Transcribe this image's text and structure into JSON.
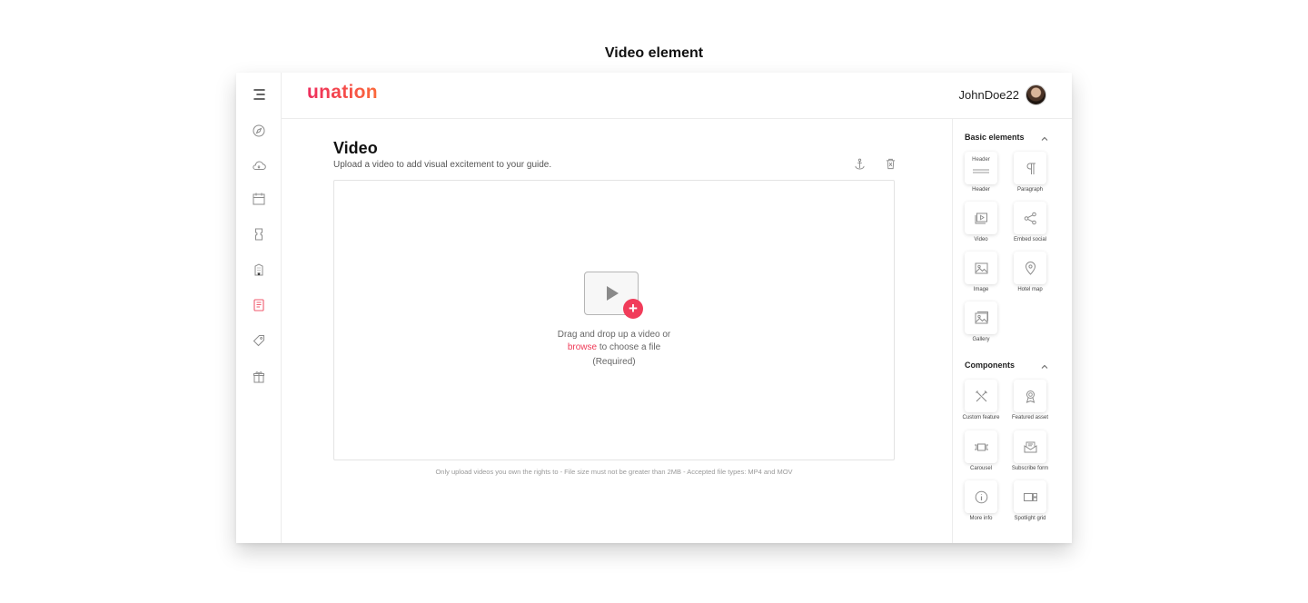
{
  "page_heading": "Video element",
  "header": {
    "logo": "unation",
    "username": "JohnDoe22"
  },
  "nav_icons": [
    "menu-icon",
    "compass-icon",
    "cloud-icon",
    "calendar-icon",
    "ticket-icon",
    "building-icon",
    "guide-icon",
    "tag-icon",
    "gift-icon"
  ],
  "main": {
    "title": "Video",
    "subtitle": "Upload a video to add visual excitement to your guide.",
    "dropzone": {
      "line1": "Drag and drop up a video or",
      "browse": "browse",
      "line2_rest": " to choose a file",
      "required": "(Required)"
    },
    "footnote": "Only upload videos you own the rights to  -  File size must not be greater than 2MB  -  Accepted file types: MP4 and MOV"
  },
  "sidebar": {
    "basic_title": "Basic elements",
    "basic_items": [
      {
        "label": "Header",
        "icon": "header-icon"
      },
      {
        "label": "Paragraph",
        "icon": "paragraph-icon"
      },
      {
        "label": "Video",
        "icon": "video-icon"
      },
      {
        "label": "Embed social",
        "icon": "share-icon"
      },
      {
        "label": "Image",
        "icon": "image-icon"
      },
      {
        "label": "Hotel map",
        "icon": "map-pin-icon"
      },
      {
        "label": "Gallery",
        "icon": "gallery-icon"
      }
    ],
    "header_glyph": "Header",
    "components_title": "Components",
    "component_items": [
      {
        "label": "Custom feature",
        "icon": "tools-icon"
      },
      {
        "label": "Featured asset",
        "icon": "award-icon"
      },
      {
        "label": "Carousel",
        "icon": "carousel-icon"
      },
      {
        "label": "Subscribe form",
        "icon": "envelope-icon"
      },
      {
        "label": "More info",
        "icon": "info-icon"
      },
      {
        "label": "Spotlight grid",
        "icon": "spotlight-icon"
      }
    ]
  },
  "colors": {
    "accent": "#ef3a57",
    "active_nav": "#f05a6e",
    "icon_gray": "#8c8c8c"
  }
}
